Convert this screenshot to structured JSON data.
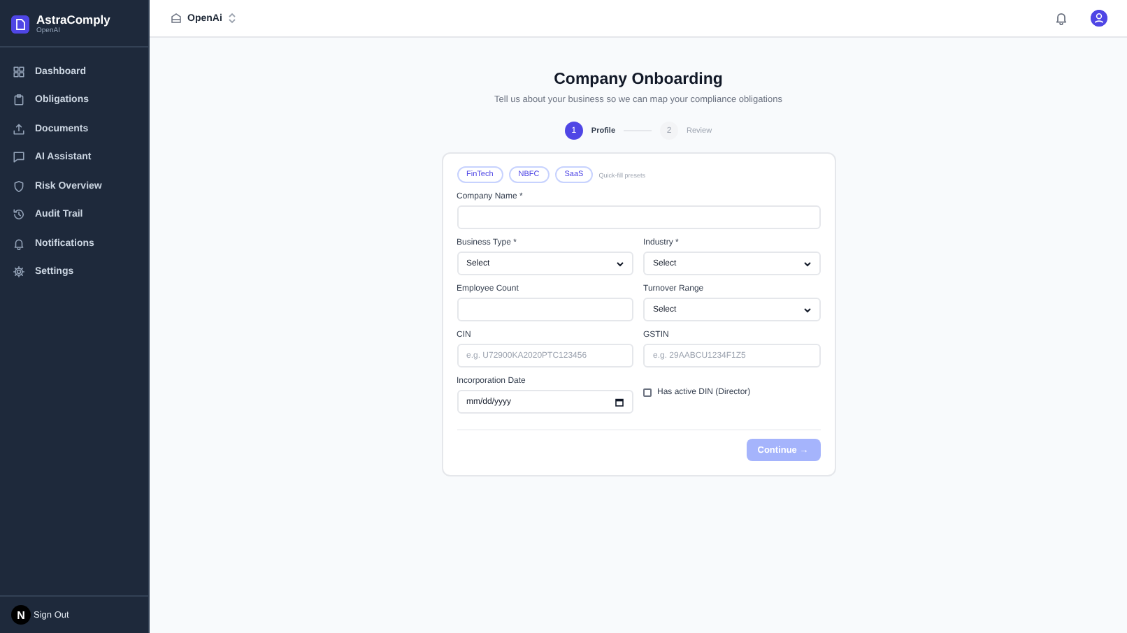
{
  "sidebar": {
    "brand": "AstraComply",
    "org": "OpenAI",
    "items": [
      {
        "label": "Dashboard",
        "selected": false
      },
      {
        "label": "Obligations",
        "selected": false
      },
      {
        "label": "Documents",
        "selected": false
      },
      {
        "label": "AI Assistant",
        "selected": false
      },
      {
        "label": "Risk Overview",
        "selected": false
      },
      {
        "label": "Audit Trail",
        "selected": false
      },
      {
        "label": "Notifications",
        "selected": false
      },
      {
        "label": "Settings",
        "selected": false
      }
    ],
    "dev_badge": "N",
    "sign_out": "Sign Out"
  },
  "header": {
    "org": "OpenAi"
  },
  "page": {
    "title": "Company Onboarding",
    "subtitle": "Tell us about your business so we can map your compliance obligations",
    "steps": [
      {
        "number": "1",
        "label": "Profile",
        "selected": true
      },
      {
        "number": "2",
        "label": "Review",
        "selected": false
      }
    ]
  },
  "form": {
    "presets": [
      "FinTech",
      "NBFC",
      "SaaS"
    ],
    "presets_hint": "Quick-fill presets",
    "fields": [
      {
        "kind": "wide",
        "label": "Company Name *"
      },
      {
        "kind": "select",
        "label": "Business Type *",
        "value": "Select"
      },
      {
        "kind": "select",
        "label": "Industry *",
        "value": "Select"
      },
      {
        "kind": "input",
        "label": "Employee Count"
      },
      {
        "kind": "select",
        "label": "Turnover Range",
        "value": "Select"
      },
      {
        "kind": "input",
        "label": "CIN",
        "placeholder": "e.g. U72900KA2020PTC123456"
      },
      {
        "kind": "input",
        "label": "GSTIN",
        "placeholder": "e.g. 29AABCU1234F1Z5"
      },
      {
        "kind": "date",
        "label": "Incorporation Date",
        "value": "mm/dd/yyyy"
      },
      {
        "kind": "checkbox",
        "label": "Has active DIN (Director)",
        "checked": false
      }
    ],
    "submit": {
      "label": "Continue →",
      "disabled": true
    }
  }
}
